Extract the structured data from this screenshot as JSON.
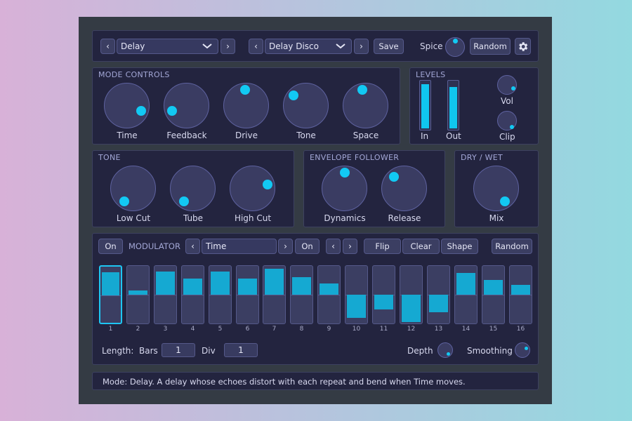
{
  "preset_bar": {
    "category": "Delay",
    "preset": "Delay Disco",
    "save_label": "Save",
    "spice_label": "Spice",
    "random_label": "Random"
  },
  "mode_controls": {
    "title": "MODE CONTROLS",
    "knobs": [
      {
        "label": "Time",
        "value": 0.62
      },
      {
        "label": "Feedback",
        "value": 0.22
      },
      {
        "label": "Drive",
        "value": 0.47
      },
      {
        "label": "Tone",
        "value": 0.35
      },
      {
        "label": "Space",
        "value": 0.55
      }
    ]
  },
  "levels": {
    "title": "LEVELS",
    "in_label": "In",
    "out_label": "Out",
    "in_level": 0.95,
    "out_level": 0.9,
    "vol_label": "Vol",
    "clip_label": "Clip"
  },
  "tone": {
    "title": "TONE",
    "knobs": [
      {
        "label": "Low Cut"
      },
      {
        "label": "Tube"
      },
      {
        "label": "High Cut"
      }
    ]
  },
  "envelope": {
    "title": "ENVELOPE FOLLOWER",
    "knobs": [
      {
        "label": "Dynamics"
      },
      {
        "label": "Release"
      }
    ]
  },
  "drywet": {
    "title": "DRY / WET",
    "knob": {
      "label": "Mix"
    }
  },
  "modulator": {
    "on_label": "On",
    "title": "MODULATOR",
    "target": "Time",
    "on2_label": "On",
    "flip_label": "Flip",
    "clear_label": "Clear",
    "shape_label": "Shape",
    "random_label": "Random",
    "selected_step": 1,
    "steps": [
      {
        "n": "1",
        "v": 0.85
      },
      {
        "n": "2",
        "v": 0.15
      },
      {
        "n": "3",
        "v": 0.85
      },
      {
        "n": "4",
        "v": 0.6
      },
      {
        "n": "5",
        "v": 0.85
      },
      {
        "n": "6",
        "v": 0.6
      },
      {
        "n": "7",
        "v": 0.95
      },
      {
        "n": "8",
        "v": 0.65
      },
      {
        "n": "9",
        "v": 0.4
      },
      {
        "n": "10",
        "v": -0.85
      },
      {
        "n": "11",
        "v": -0.55
      },
      {
        "n": "12",
        "v": -1.0
      },
      {
        "n": "13",
        "v": -0.65
      },
      {
        "n": "14",
        "v": 0.8
      },
      {
        "n": "15",
        "v": 0.55
      },
      {
        "n": "16",
        "v": 0.35
      }
    ],
    "length_label": "Length:",
    "bars_label": "Bars",
    "bars_value": "1",
    "div_label": "Div",
    "div_value": "1",
    "depth_label": "Depth",
    "smoothing_label": "Smoothing"
  },
  "status": {
    "text": "Mode: Delay. A delay whose echoes distort with each repeat and bend when Time moves."
  },
  "colors": {
    "accent": "#12c9f3",
    "panel": "#23243f",
    "frame": "#343b44"
  }
}
